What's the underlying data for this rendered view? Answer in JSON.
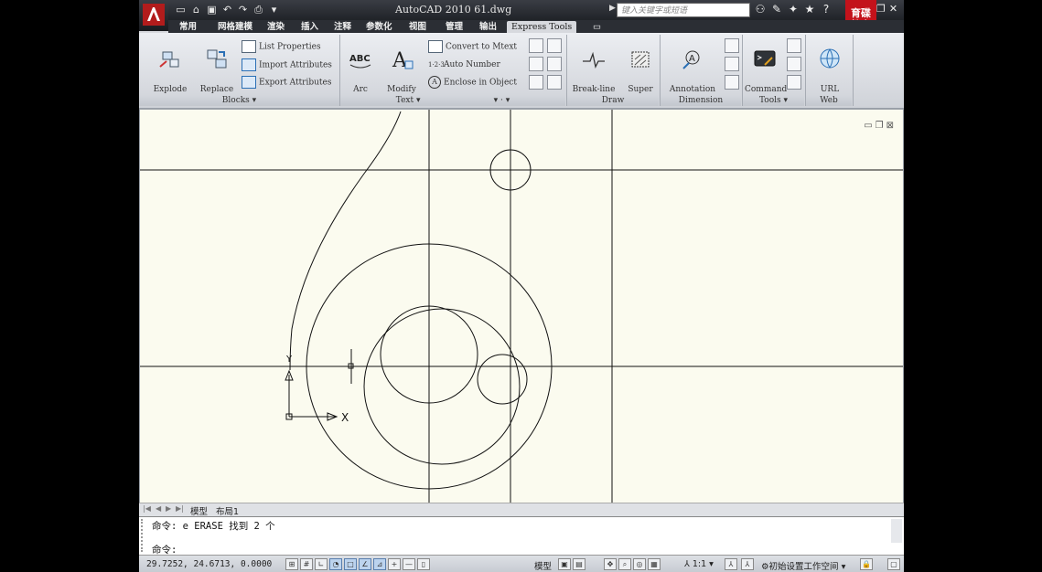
{
  "window": {
    "title": "AutoCAD 2010   61.dwg",
    "search_placeholder": "键入关键字或短语",
    "logo_text": "育碟\n教育"
  },
  "tabs": [
    {
      "label": "常用"
    },
    {
      "label": "网格建模"
    },
    {
      "label": "渲染"
    },
    {
      "label": "插入"
    },
    {
      "label": "注释"
    },
    {
      "label": "参数化"
    },
    {
      "label": "视图"
    },
    {
      "label": "管理"
    },
    {
      "label": "输出"
    },
    {
      "label": "Express Tools",
      "active": true
    }
  ],
  "ribbon": {
    "blocks": {
      "title": "Blocks",
      "explode": "Explode\nAttributes",
      "replace": "Replace\nBlock",
      "list": "List Properties",
      "import": "Import Attributes",
      "export": "Export Attributes"
    },
    "text": {
      "title": "Text",
      "arc": "Arc\nAligned",
      "modify": "Modify\nText",
      "convert": "Convert to Mtext",
      "auto_number": "Auto Number",
      "enclose": "Enclose in Object"
    },
    "draw": {
      "title": "Draw",
      "breakline": "Break-line\nSymbol",
      "superhatch": "Super\nHatch"
    },
    "dimension": {
      "title": "Dimension",
      "annotation": "Annotation\nAttachment"
    },
    "tools": {
      "title": "Tools",
      "command_aliases": "Command\nAliases"
    },
    "web": {
      "title": "Web",
      "url_options": "URL\nOptions"
    }
  },
  "layout_tabs": [
    "模型",
    "布局1"
  ],
  "command": {
    "history": "命令: e ERASE 找到 2 个",
    "prompt": "命令:"
  },
  "status": {
    "coords": "29.7252,  24.6713, 0.0000",
    "model": "模型",
    "scale": "1:1",
    "workspace": "初始设置工作空间"
  },
  "colors": {
    "drawing_bg": "#fbfbef",
    "title_bg": "#2b2e34",
    "ribbon_bg": "#e4e6ea"
  }
}
